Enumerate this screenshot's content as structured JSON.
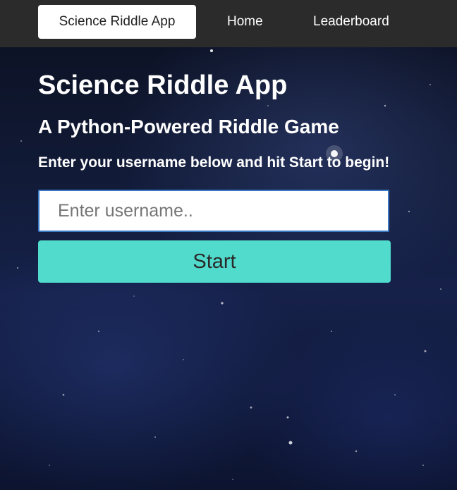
{
  "nav": {
    "brand": "Science Riddle App",
    "home": "Home",
    "leaderboard": "Leaderboard"
  },
  "main": {
    "title": "Science Riddle App",
    "subtitle": "A Python-Powered Riddle Game",
    "instruction": "Enter your username below and hit Start to begin!",
    "username_placeholder": "Enter username..",
    "username_value": "",
    "start_label": "Start"
  },
  "colors": {
    "navbar_bg": "#2b2b2b",
    "start_button": "#50dbcc",
    "input_border": "#3a78c4",
    "background": "starry night sky"
  }
}
